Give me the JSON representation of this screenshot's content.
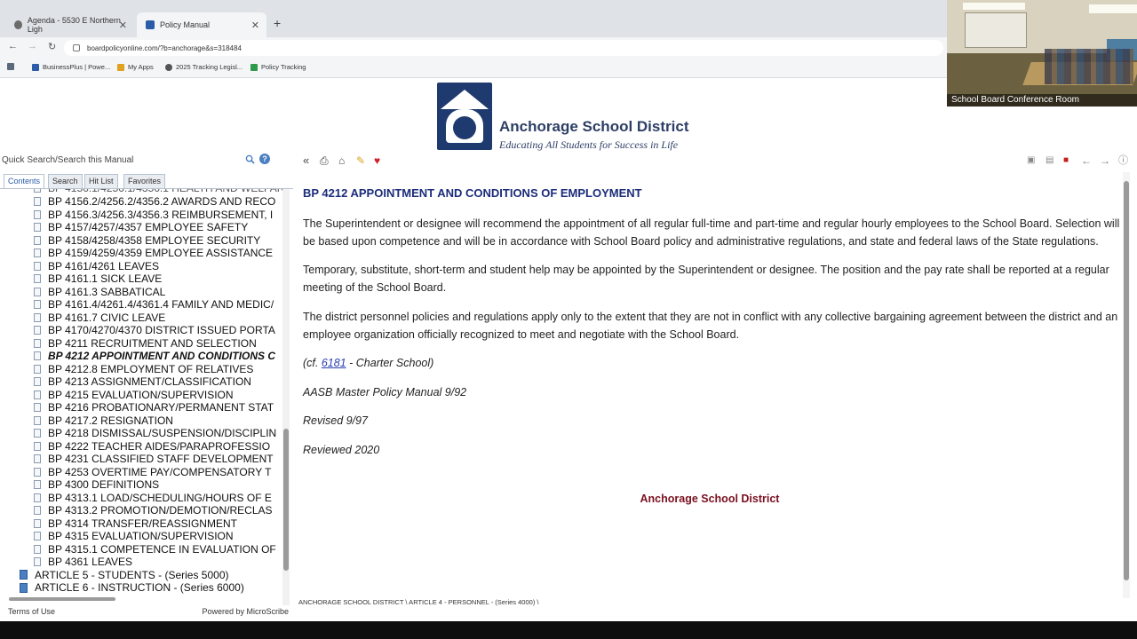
{
  "browser": {
    "tabs": [
      {
        "label": "Agenda - 5530 E Northern Ligh"
      },
      {
        "label": "Policy Manual"
      }
    ],
    "url": "boardpolicyonline.com/?b=anchorage&s=318484",
    "bookmarks": [
      {
        "label": "BusinessPlus | Powe..."
      },
      {
        "label": "My Apps"
      },
      {
        "label": "2025 Tracking Legisl..."
      },
      {
        "label": "Policy Tracking"
      }
    ]
  },
  "header": {
    "org_name": "Anchorage School District",
    "slogan": "Educating All Students for Success in Life"
  },
  "left_panel": {
    "search_placeholder": "Quick Search/Search this Manual",
    "tabs": [
      "Contents",
      "Search",
      "Hit List",
      "Favorites"
    ],
    "tree_items": [
      {
        "label": "BP 4156.2/4256.2/4356.2 AWARDS AND RECO"
      },
      {
        "label": "BP 4156.3/4256.3/4356.3 REIMBURSEMENT, I"
      },
      {
        "label": "BP 4157/4257/4357 EMPLOYEE SAFETY"
      },
      {
        "label": "BP 4158/4258/4358 EMPLOYEE SECURITY"
      },
      {
        "label": "BP 4159/4259/4359 EMPLOYEE ASSISTANCE"
      },
      {
        "label": "BP 4161/4261 LEAVES"
      },
      {
        "label": "BP 4161.1 SICK LEAVE"
      },
      {
        "label": "BP 4161.3 SABBATICAL"
      },
      {
        "label": "BP 4161.4/4261.4/4361.4 FAMILY AND MEDIC/"
      },
      {
        "label": "BP 4161.7 CIVIC LEAVE"
      },
      {
        "label": "BP 4170/4270/4370 DISTRICT ISSUED PORTA"
      },
      {
        "label": "BP 4211 RECRUITMENT AND SELECTION"
      },
      {
        "label": "BP 4212 APPOINTMENT AND CONDITIONS C"
      },
      {
        "label": "BP 4212.8 EMPLOYMENT OF RELATIVES"
      },
      {
        "label": "BP 4213 ASSIGNMENT/CLASSIFICATION"
      },
      {
        "label": "BP 4215 EVALUATION/SUPERVISION"
      },
      {
        "label": "BP 4216 PROBATIONARY/PERMANENT STAT"
      },
      {
        "label": "BP 4217.2 RESIGNATION"
      },
      {
        "label": "BP 4218 DISMISSAL/SUSPENSION/DISCIPLIN"
      },
      {
        "label": "BP 4222 TEACHER AIDES/PARAPROFESSIO"
      },
      {
        "label": "BP 4231 CLASSIFIED STAFF DEVELOPMENT"
      },
      {
        "label": "BP 4253 OVERTIME PAY/COMPENSATORY T"
      },
      {
        "label": "BP 4300 DEFINITIONS"
      },
      {
        "label": "BP 4313.1 LOAD/SCHEDULING/HOURS OF E"
      },
      {
        "label": "BP 4313.2 PROMOTION/DEMOTION/RECLAS"
      },
      {
        "label": "BP 4314 TRANSFER/REASSIGNMENT"
      },
      {
        "label": "BP 4315 EVALUATION/SUPERVISION"
      },
      {
        "label": "BP 4315.1 COMPETENCE IN EVALUATION OF"
      },
      {
        "label": "BP 4361 LEAVES"
      }
    ],
    "articles": [
      {
        "label": "ARTICLE 5 - STUDENTS - (Series 5000)"
      },
      {
        "label": "ARTICLE 6 - INSTRUCTION - (Series 6000)"
      }
    ],
    "footer_terms": "Terms of Use",
    "footer_powered": "Powered by MicroScribe"
  },
  "document": {
    "title": "BP 4212 APPOINTMENT AND CONDITIONS OF EMPLOYMENT",
    "paragraphs": [
      "The Superintendent or designee will recommend the appointment of all regular full-time and part-time and regular hourly employees to the School Board. Selection will be based upon competence and will be in accordance with School Board policy and administrative regulations, and state and federal laws of the State regulations.",
      "Temporary, substitute, short-term and student help may be appointed by the Superintendent or designee. The position and the pay rate shall be reported at a regular meeting of the School Board.",
      "The district personnel policies and regulations apply only to the extent that they are not in conflict with any collective bargaining agreement between the district and an employee organization officially recognized to meet and negotiate with the School Board."
    ],
    "cf_prefix": "(cf. ",
    "cf_link": "6181",
    "cf_suffix": " - Charter School)",
    "source": "AASB Master Policy Manual 9/92",
    "revised": "Revised 9/97",
    "reviewed": "Reviewed 2020",
    "footer_org": "Anchorage School District",
    "breadcrumb": "ANCHORAGE SCHOOL DISTRICT \\ ARTICLE 4 - PERSONNEL - (Series 4000) \\"
  },
  "video": {
    "label": "School Board Conference Room"
  },
  "colors": {
    "title": "#1b2c7a",
    "footer_org": "#7a1020",
    "link": "#2a3fb5",
    "favorite": "#d0202a"
  }
}
